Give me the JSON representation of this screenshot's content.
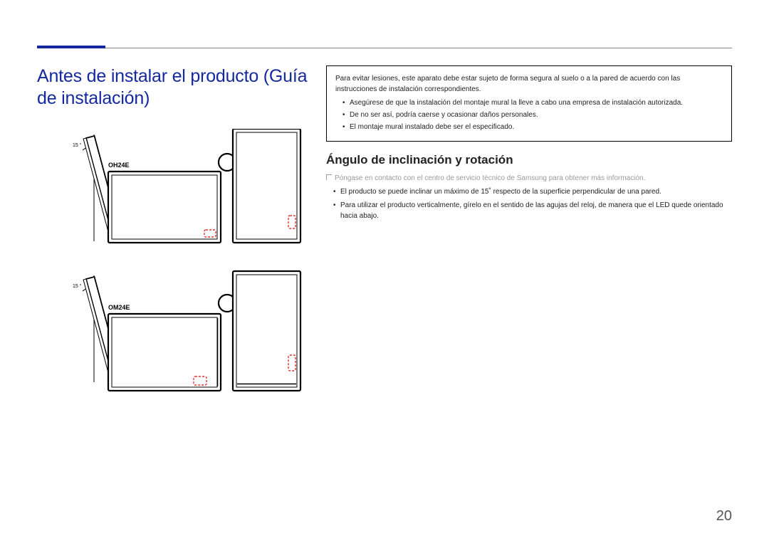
{
  "title": "Antes de instalar el producto (Guía de instalación)",
  "diagrams": {
    "tilt_angle": "15 °",
    "model1": "OH24E",
    "model2": "OM24E"
  },
  "warning_box": {
    "intro": "Para evitar lesiones, este aparato debe estar sujeto de forma segura al suelo o a la pared de acuerdo con las instrucciones de instalación correspondientes.",
    "items": [
      "Asegúrese de que la instalación del montaje mural la lleve a cabo una empresa de instalación autorizada.",
      "De no ser así, podría caerse y ocasionar daños personales.",
      "El montaje mural instalado debe ser el especificado."
    ]
  },
  "section2": {
    "heading": "Ángulo de inclinación y rotación",
    "note": "Póngase en contacto con el centro de servicio técnico de Samsung para obtener más información.",
    "items": [
      "El producto se puede inclinar un máximo de 15˚ respecto de la superficie perpendicular de una pared.",
      "Para utilizar el producto verticalmente, gírelo en el sentido de las agujas del reloj, de manera que el LED quede orientado hacia abajo."
    ]
  },
  "page_number": "20"
}
